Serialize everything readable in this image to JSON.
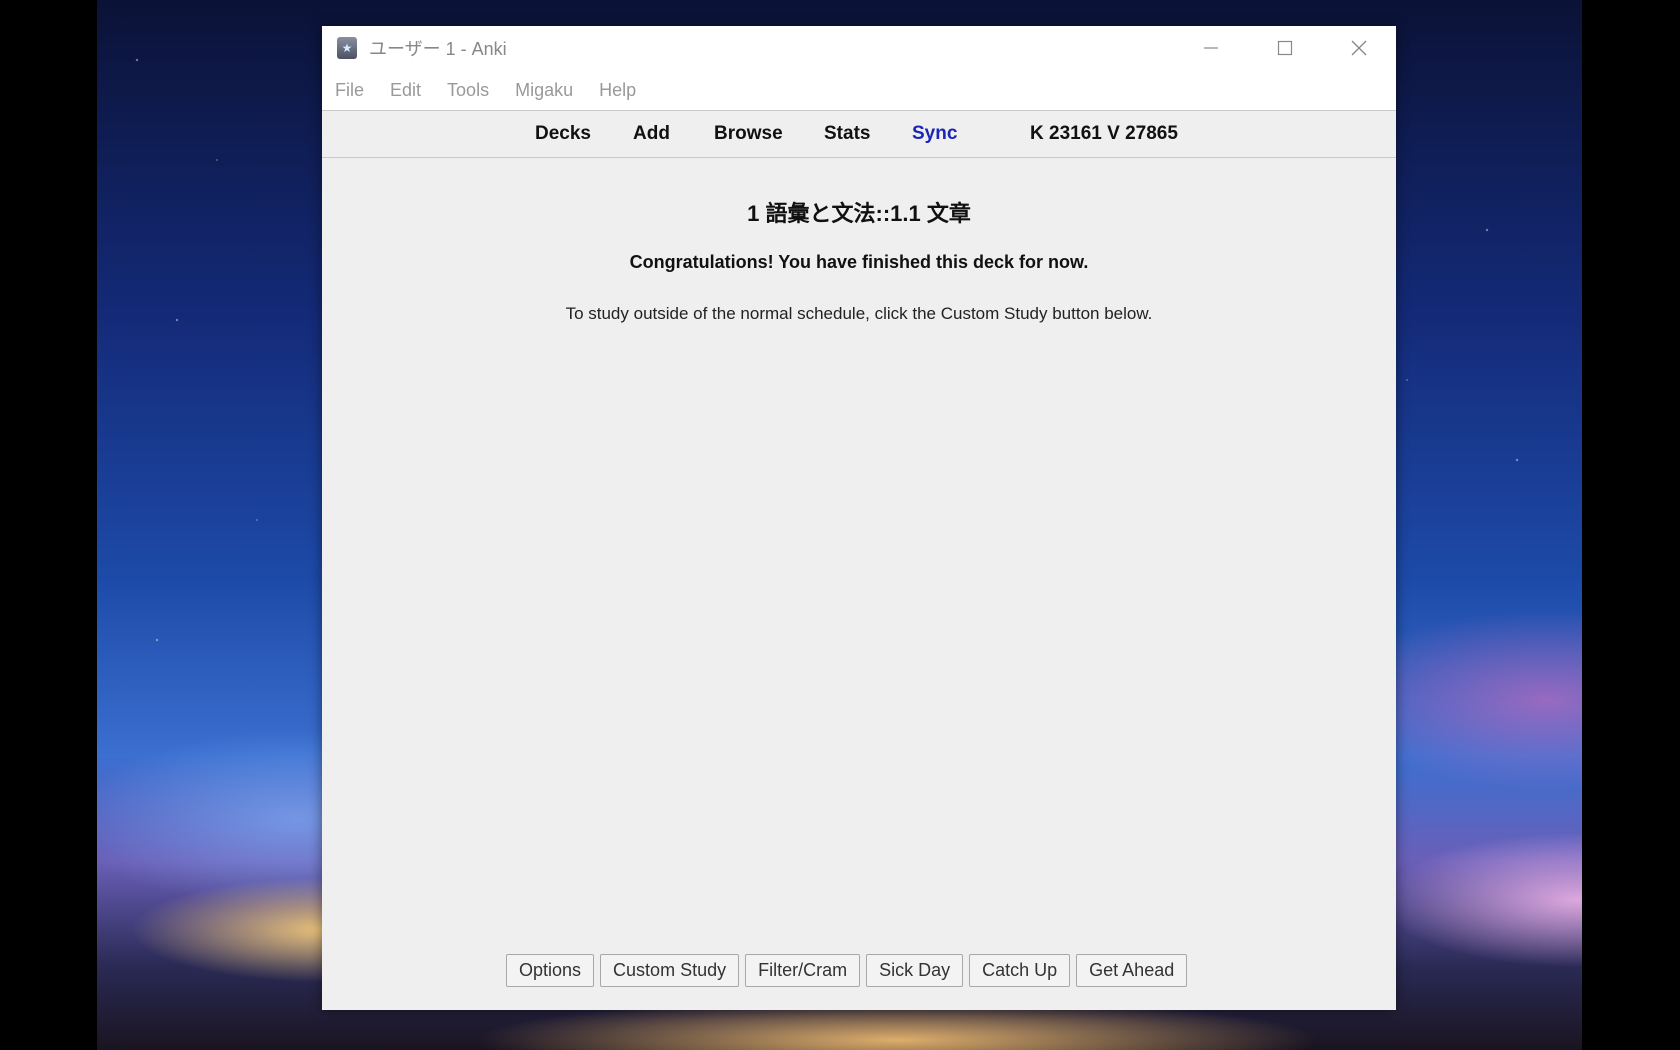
{
  "window": {
    "title": "ユーザー 1 - Anki",
    "app_icon": "anki-star-icon",
    "controls": {
      "minimize_icon": "minimize-icon",
      "maximize_icon": "maximize-icon",
      "close_icon": "close-icon"
    }
  },
  "menubar": {
    "items": [
      "File",
      "Edit",
      "Tools",
      "Migaku",
      "Help"
    ]
  },
  "toolbar": {
    "decks": "Decks",
    "add": "Add",
    "browse": "Browse",
    "stats": "Stats",
    "sync": "Sync",
    "counter": "K 23161 V 27865",
    "sync_color": "#1a26b8"
  },
  "overview": {
    "deck_name": "1 語彙と文法::1.1 文章",
    "congrats": "Congratulations! You have finished this deck for now.",
    "info": "To study outside of the normal schedule, click the Custom Study button below."
  },
  "buttons": {
    "options": "Options",
    "custom_study": "Custom Study",
    "filter_cram": "Filter/Cram",
    "sick_day": "Sick Day",
    "catch_up": "Catch Up",
    "get_ahead": "Get Ahead"
  }
}
